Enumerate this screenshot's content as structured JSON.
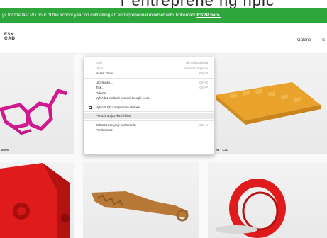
{
  "top_ghost_text": "r entreprene    ng npic",
  "banner": {
    "text": "ys for the last PD hour of the school year on cultivating an entrepreneurial mindset with Tinkercad!",
    "link": "RSVP here."
  },
  "header": {
    "logo_line1": "ESK",
    "logo_line2": "CAD",
    "nav_gallery": "Galerie",
    "nav_more": "S"
  },
  "cards": [
    {
      "caption": "ases"
    },
    {
      "caption": ""
    },
    {
      "caption": "ler - Cat"
    },
    {
      "caption": ""
    },
    {
      "caption": ""
    },
    {
      "caption": ""
    }
  ],
  "context_menu": {
    "items": [
      {
        "label": "Zpět",
        "shortcut": "Alt+Šipka doleva",
        "disabled": true
      },
      {
        "label": "Vpřed",
        "shortcut": "Alt+Šipka doprava",
        "disabled": true
      },
      {
        "label": "Načíst znovu",
        "shortcut": "Ctrl+R",
        "disabled": false
      },
      {
        "label": "Uložit jako...",
        "shortcut": "Ctrl+S",
        "disabled": false
      },
      {
        "label": "Tisk...",
        "shortcut": "Ctrl+P",
        "disabled": false
      },
      {
        "label": "Odeslat...",
        "shortcut": "",
        "disabled": false
      },
      {
        "label": "Vyhledat obrázek pomocí Google Lens",
        "shortcut": "",
        "disabled": false
      },
      {
        "label": "Vytvořit QR kód pro tuto stránku",
        "shortcut": "",
        "disabled": false
      },
      {
        "label": "Přeložit do jazyka čeština",
        "shortcut": "",
        "disabled": false
      },
      {
        "label": "Zobrazit zdrojový kód stránky",
        "shortcut": "Ctrl+U",
        "disabled": false
      },
      {
        "label": "Prozkoumat",
        "shortcut": "",
        "disabled": false
      }
    ]
  },
  "colors": {
    "banner_green": "#2fa63c",
    "magenta_model": "#d0188f",
    "orange_model": "#e9a22b",
    "red_model": "#e01b1b",
    "brown_model": "#b87838"
  }
}
